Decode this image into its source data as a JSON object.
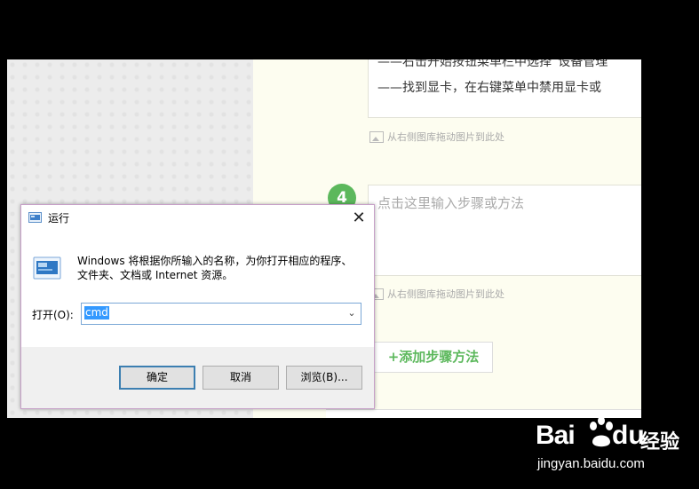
{
  "background_page": {
    "step3_lines": [
      "——右击开始按钮菜单栏中选择“设备管理",
      "——找到显卡，在右键菜单中禁用显卡或"
    ],
    "image_drop_hint": "从右侧图库拖动图片到此处",
    "step4_number": "4",
    "step_placeholder": "点击这里输入步骤或方法",
    "add_step_label": "+添加步骤方法"
  },
  "run_dialog": {
    "title": "运行",
    "description": "Windows 将根据你所输入的名称，为你打开相应的程序、文件夹、文档或 Internet 资源。",
    "open_label": "打开(O):",
    "command_value": "cmd",
    "ok_label": "确定",
    "cancel_label": "取消",
    "browse_label": "浏览(B)...",
    "close_glyph": "✕",
    "dropdown_glyph": "⌄",
    "icons": [
      "run-icon",
      "close-icon",
      "chevron-down-icon"
    ]
  },
  "watermark": {
    "brand_left": "Bai",
    "brand_right": "du",
    "brand_cn": "经验",
    "url": "jingyan.baidu.com"
  },
  "colors": {
    "step_green": "#5cb85c",
    "selection_blue": "#3399ff",
    "default_button_border": "#3c7fb1"
  }
}
